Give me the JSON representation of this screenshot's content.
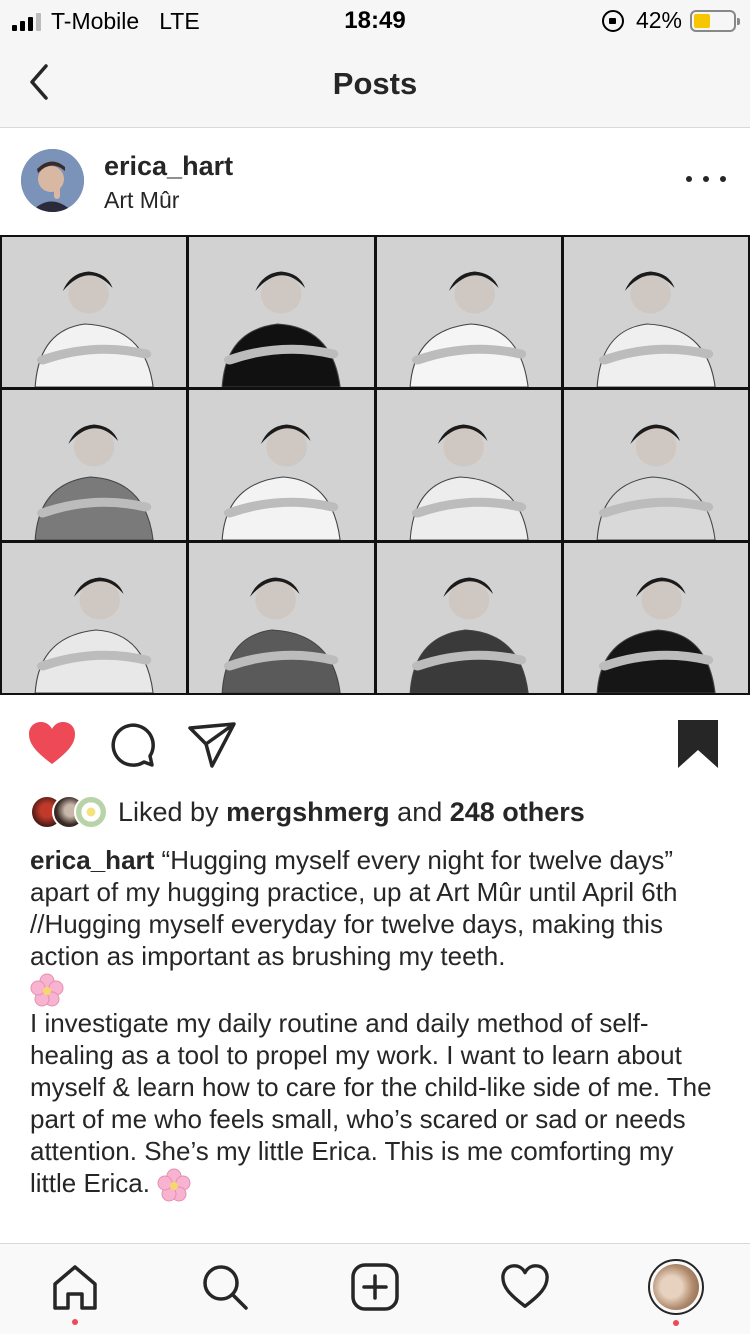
{
  "status_bar": {
    "carrier": "T-Mobile",
    "network": "LTE",
    "time": "18:49",
    "battery": "42%",
    "battery_level": 0.42,
    "battery_color": "#f7c600"
  },
  "nav": {
    "title": "Posts",
    "back_icon": "chevron-left-icon"
  },
  "post": {
    "username": "erica_hart",
    "location": "Art Mûr",
    "more_icon": "ellipsis-icon",
    "image_grid": {
      "columns": 4,
      "rows": 3
    },
    "actions": {
      "liked": true,
      "like_color": "#ed4956",
      "icons": [
        "heart-filled-icon",
        "comment-icon",
        "share-icon",
        "bookmark-filled-icon"
      ]
    },
    "likes": {
      "prefix": "Liked by",
      "user": "mergshmerg",
      "middle": "and",
      "others": "248 others"
    },
    "caption": {
      "username": "erica_hart",
      "part1": "“Hugging myself every night for twelve days” apart of my hugging practice, up at Art Mûr until April 6th //Hugging myself everyday for twelve days, making this action as important as brushing my teeth.",
      "part2": "I investigate my daily routine and daily method of self-healing as a tool to propel my work. I want to learn about myself & learn how to care for the child-like side of me. The part of me who feels small, who’s scared or sad or needs attention. She’s my little Erica. This is me comforting my little Erica.",
      "emoji_name": "cherry-blossom-icon"
    }
  },
  "tab_bar": {
    "tabs": [
      "home-icon",
      "search-icon",
      "add-post-icon",
      "activity-icon",
      "profile-icon"
    ],
    "notification_color": "#ed4956"
  }
}
